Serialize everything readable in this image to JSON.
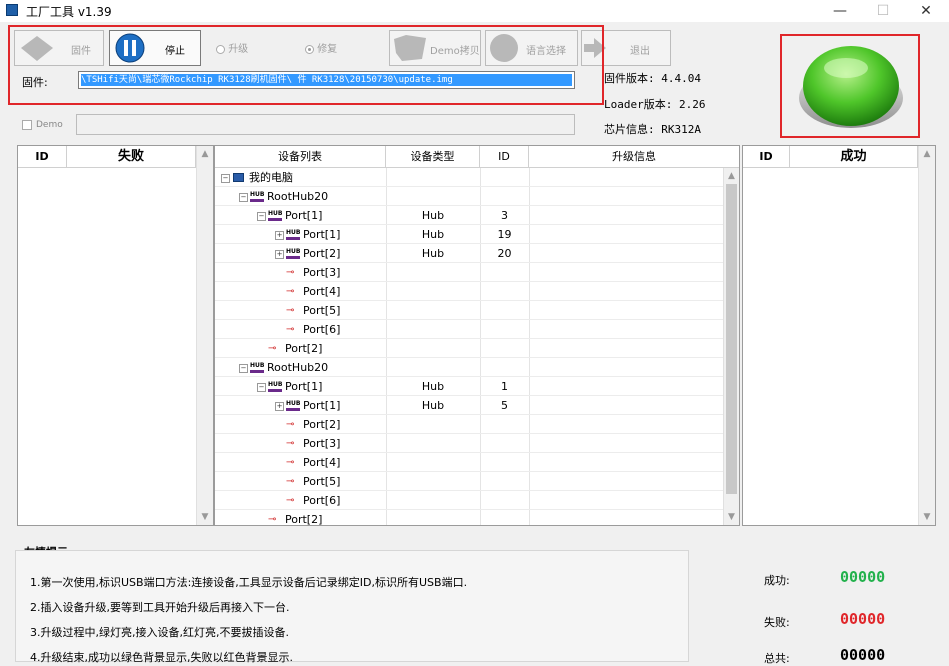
{
  "window": {
    "title": "工厂工具 v1.39",
    "min": "—",
    "max": "☐",
    "close": "✕"
  },
  "toolbar": {
    "firmware_label": "固件",
    "stop_label": "停止",
    "upgrade_label": "升级",
    "repair_label": "修复",
    "demo_copy_label": "Demo拷贝",
    "language_label": "语言选择",
    "exit_label": "退出"
  },
  "firmware": {
    "label": "固件:",
    "path": "\\TSHifi天尚\\瑞芯微Rockchip RK3128刷机固件\\                   件 RK3128\\20150730\\update.img"
  },
  "demo": {
    "label": "Demo"
  },
  "info": {
    "fw_version": "固件版本: 4.4.04",
    "loader_version": "Loader版本: 2.26",
    "chip_info": "芯片信息: RK312A"
  },
  "fail_panel": {
    "col_id": "ID",
    "col_status": "失败"
  },
  "success_panel": {
    "col_id": "ID",
    "col_status": "成功"
  },
  "device_table": {
    "headers": {
      "device_list": "设备列表",
      "device_type": "设备类型",
      "id": "ID",
      "upgrade_info": "升级信息"
    },
    "rows": [
      {
        "label": "我的电脑",
        "type": "",
        "id": ""
      },
      {
        "label": "RootHub20",
        "type": "",
        "id": ""
      },
      {
        "label": "Port[1]",
        "type": "Hub",
        "id": "3"
      },
      {
        "label": "Port[1]",
        "type": "Hub",
        "id": "19"
      },
      {
        "label": "Port[2]",
        "type": "Hub",
        "id": "20"
      },
      {
        "label": "Port[3]",
        "type": "",
        "id": ""
      },
      {
        "label": "Port[4]",
        "type": "",
        "id": ""
      },
      {
        "label": "Port[5]",
        "type": "",
        "id": ""
      },
      {
        "label": "Port[6]",
        "type": "",
        "id": ""
      },
      {
        "label": "Port[2]",
        "type": "",
        "id": ""
      },
      {
        "label": "RootHub20",
        "type": "",
        "id": ""
      },
      {
        "label": "Port[1]",
        "type": "Hub",
        "id": "1"
      },
      {
        "label": "Port[1]",
        "type": "Hub",
        "id": "5"
      },
      {
        "label": "Port[2]",
        "type": "",
        "id": ""
      },
      {
        "label": "Port[3]",
        "type": "",
        "id": ""
      },
      {
        "label": "Port[4]",
        "type": "",
        "id": ""
      },
      {
        "label": "Port[5]",
        "type": "",
        "id": ""
      },
      {
        "label": "Port[6]",
        "type": "",
        "id": ""
      },
      {
        "label": "Port[2]",
        "type": "",
        "id": ""
      }
    ]
  },
  "tips": {
    "title": "友情提示:",
    "items": [
      "1.第一次使用,标识USB端口方法:连接设备,工具显示设备后记录绑定ID,标识所有USB端口.",
      "2.插入设备升级,要等到工具开始升级后再接入下一台.",
      "3.升级过程中,绿灯亮,接入设备,红灯亮,不要拔插设备.",
      "4.升级结束,成功以绿色背景显示,失败以红色背景显示."
    ]
  },
  "counters": {
    "success_label": "成功:",
    "success_value": "00000",
    "fail_label": "失败:",
    "fail_value": "00000",
    "total_label": "总共:",
    "total_value": "00000"
  },
  "colors": {
    "highlight_border": "#e0262a",
    "success_green": "#22b14c",
    "fail_red": "#e0262a",
    "selection_blue": "#3399ff"
  }
}
